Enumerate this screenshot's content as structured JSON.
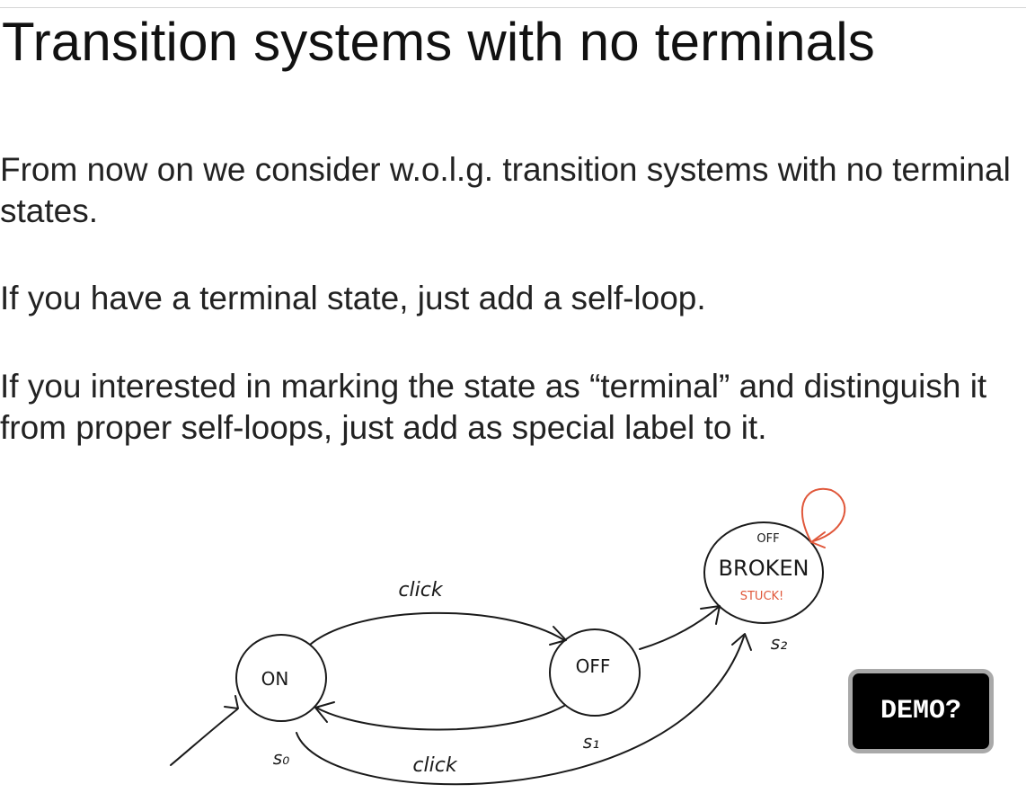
{
  "slide": {
    "title": "Transition systems with no terminals",
    "paragraphs": [
      "From now on we consider w.o.l.g. transition systems with no terminal states.",
      "If you have a terminal state, just add a self-loop.",
      "If you interested in marking the state as “terminal” and distinguish it from proper self-loops, just add as special label to it."
    ]
  },
  "diagram": {
    "states": {
      "s0": {
        "label": "ON",
        "name": "s₀"
      },
      "s1": {
        "label": "OFF",
        "name": "s₁"
      },
      "s2": {
        "label": "BROKEN",
        "name": "s₂",
        "prop_label": "OFF",
        "annotation": "STUCK!"
      }
    },
    "edges": {
      "s0_s1": "click",
      "s1_s0": "click"
    },
    "colors": {
      "ink": "#1a1a1a",
      "self_loop": "#e0573a",
      "stuck": "#e0573a"
    }
  },
  "demo_button": {
    "label": "DEMO?"
  }
}
